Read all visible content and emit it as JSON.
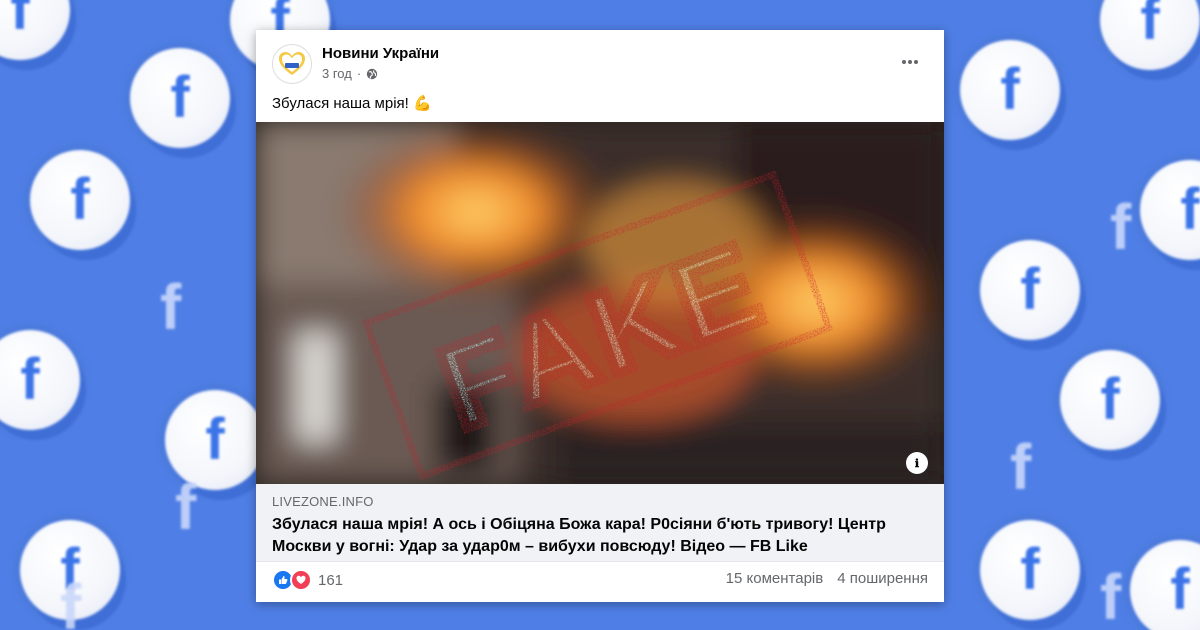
{
  "background": {
    "coin_letter": "f",
    "color": "#4f7fe6"
  },
  "post": {
    "page_name": "Новини України",
    "timestamp": "3 год",
    "visibility_icon": "globe-icon",
    "more_icon": "more-horizontal-icon",
    "text": "Збулася наша мрія! 💪",
    "media": {
      "stamp_text": "FAKE",
      "stamp_color": "#c8202b",
      "badge_text": "ℹ"
    },
    "link_preview": {
      "domain": "LIVEZONE.INFO",
      "title": "Збулася наша мрія! А ось і Обіцяна Божа кара! Р0сіяни б'ють тривогу! Центр Москви у вогні: Удар за удар0м – вибухи повсюду! Відео — FB Like"
    },
    "reactions": {
      "count": "161",
      "icons": [
        "like-icon",
        "love-icon"
      ]
    },
    "comments": "15 коментарів",
    "shares": "4 поширення"
  }
}
